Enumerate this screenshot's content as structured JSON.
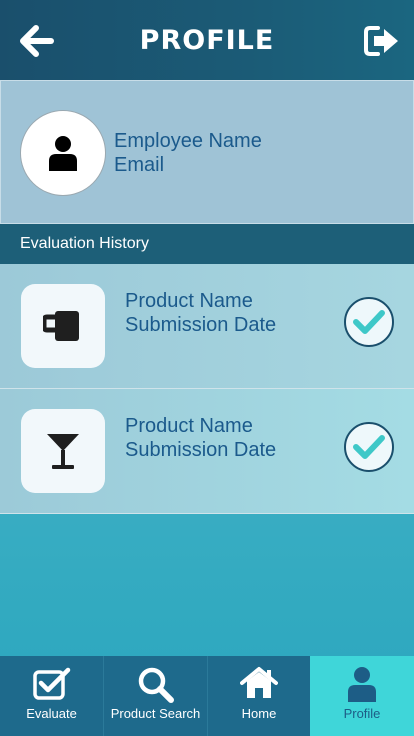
{
  "header": {
    "title": "PROFILE"
  },
  "profile": {
    "name": "Employee Name",
    "email": "Email"
  },
  "evaluation_history": {
    "title": "Evaluation History",
    "items": [
      {
        "product": "Product Name",
        "date": "Submission Date",
        "icon": "mug-icon",
        "status": "check-icon"
      },
      {
        "product": "Product Name",
        "date": "Submission Date",
        "icon": "cocktail-glass-icon",
        "status": "check-icon"
      }
    ]
  },
  "tabbar": {
    "tabs": [
      {
        "label": "Evaluate",
        "icon": "checkbox-icon"
      },
      {
        "label": "Product Search",
        "icon": "search-icon"
      },
      {
        "label": "Home",
        "icon": "home-icon"
      },
      {
        "label": "Profile",
        "icon": "user-icon",
        "active": true
      }
    ]
  },
  "colors": {
    "header": "#1a4f6c",
    "accent": "#3fd6d9",
    "text_blue": "#1b5a8c",
    "check": "#3ec8c8"
  }
}
